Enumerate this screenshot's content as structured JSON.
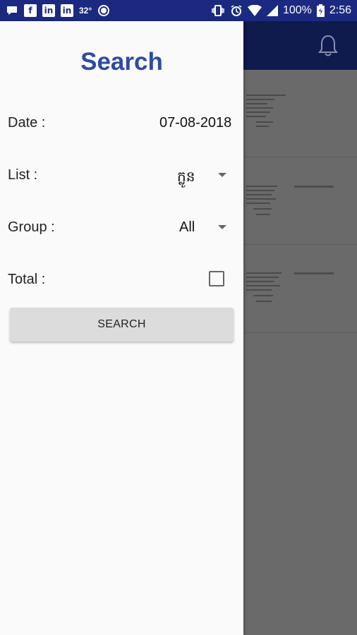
{
  "status_bar": {
    "temperature": "32°",
    "battery": "100%",
    "time": "2:56",
    "left_icons": [
      "messenger-icon",
      "facebook-icon",
      "linkedin-icon",
      "linkedin-icon"
    ],
    "right_icons": [
      "vibrate-icon",
      "alarm-icon",
      "wifi-icon",
      "signal-icon",
      "battery-icon"
    ]
  },
  "app_bar": {
    "icons": [
      "bell-icon"
    ]
  },
  "drawer": {
    "title": "Search",
    "date_label": "Date :",
    "date_value": "07-08-2018",
    "list_label": "List :",
    "list_value": "ក្លូន",
    "group_label": "Group :",
    "group_value": "All",
    "total_label": "Total :",
    "total_checked": false,
    "search_button": "SEARCH"
  },
  "colors": {
    "status_bar": "#1b2a80",
    "app_bar": "#0f1a4d",
    "title": "#2e4aa8",
    "button": "#dcdcdc",
    "scrim_area": "#6a6a6a"
  }
}
